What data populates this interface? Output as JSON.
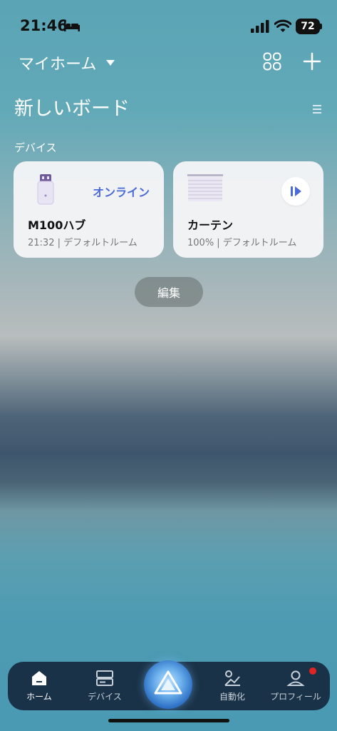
{
  "status_bar": {
    "time": "21:46",
    "battery": "72"
  },
  "header": {
    "home_name": "マイホーム"
  },
  "board": {
    "title": "新しいボード",
    "section": "デバイス"
  },
  "devices": [
    {
      "name": "M100ハブ",
      "status": "オンライン",
      "detail": "21:32 | デフォルトルーム",
      "icon": "hub-icon"
    },
    {
      "name": "カーテン",
      "detail": "100% | デフォルトルーム",
      "icon": "curtain-icon"
    }
  ],
  "edit_label": "編集",
  "tabs": [
    {
      "label": "ホーム",
      "icon": "home-icon",
      "active": true
    },
    {
      "label": "デバイス",
      "icon": "devices-icon"
    },
    {
      "label": "自動化",
      "icon": "automation-icon"
    },
    {
      "label": "プロフィール",
      "icon": "profile-icon"
    }
  ],
  "colors": {
    "accent": "#4a6ad8",
    "tabbar": "#1a3247",
    "notification": "#e02424"
  }
}
